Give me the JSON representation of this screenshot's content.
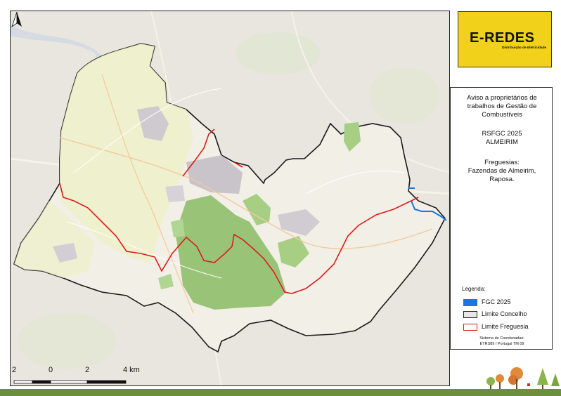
{
  "map": {
    "north_icon": "north-arrow-icon",
    "scale": {
      "labels": [
        "2",
        "0",
        "2",
        "4 km"
      ]
    },
    "legend_colors": {
      "fgc": "#1a75e0",
      "concelho_fill": "#e6e6e6",
      "concelho_border": "#222222",
      "freguesia": "#dd1c1c",
      "forest": "#8fbf6a",
      "farmland": "#eef0c8",
      "urban": "#c8c4ca"
    }
  },
  "logo": {
    "text": "E-REDES",
    "subtitle": "Distribuição de Eletricidade",
    "color": "#f2d11a"
  },
  "info": {
    "title_lines": [
      "Aviso a proprietários de",
      "trabalhos de Gestão de",
      "Combustíveis"
    ],
    "program": "RSFGC 2025",
    "municipality": "ALMEIRIM",
    "parishes_label": "Freguesias:",
    "parishes_lines": [
      "Fazendas de Almeirim,",
      "Raposa."
    ]
  },
  "legend": {
    "title": "Legenda:",
    "items": [
      {
        "label": "FGC 2025",
        "fill": "#1a75e0",
        "border": "#1a75e0"
      },
      {
        "label": "Limite Concelho",
        "fill": "#e6e6e6",
        "border": "#222222"
      },
      {
        "label": "Limite Freguesia",
        "fill": "#ffffff",
        "border": "#dd1c1c"
      }
    ],
    "coord_lines": [
      "Sistema de Coordenadas:",
      "ETRS89 / Portugal TM 09"
    ]
  }
}
